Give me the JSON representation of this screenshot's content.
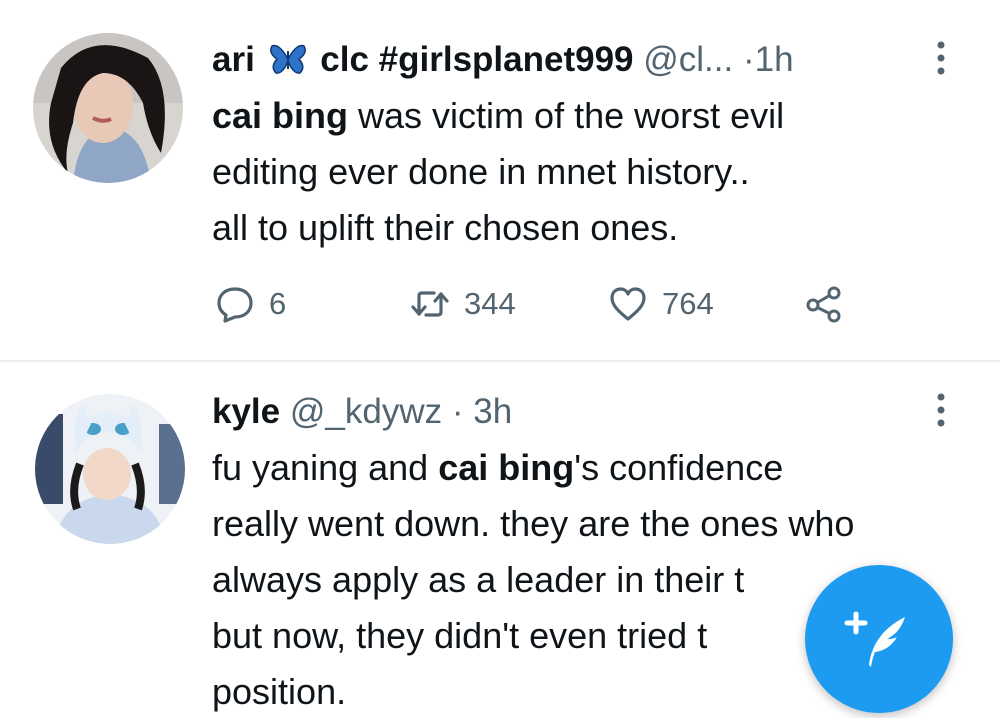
{
  "feed": {
    "tweets": [
      {
        "display_name": "ari",
        "name_suffix": "clc #girlsplanet999",
        "emoji_icon": "butterfly-icon",
        "handle": "@cl...",
        "separator": "·",
        "time": "1h",
        "body_lines": [
          {
            "bold": "cai bing",
            "rest": " was victim of the worst evil"
          },
          {
            "text": "editing ever done in mnet history.."
          },
          {
            "text": "all to uplift their chosen ones."
          }
        ],
        "stats": {
          "replies": "6",
          "retweets": "344",
          "likes": "764"
        }
      },
      {
        "display_name": "kyle",
        "handle": "@_kdywz",
        "separator": "·",
        "time": "3h",
        "body_lines": [
          {
            "pre": "fu yaning and ",
            "bold": "cai bing",
            "rest": "'s confidence"
          },
          {
            "text": "really went down. they are the ones who"
          },
          {
            "text": "always apply as a leader in their t"
          },
          {
            "text": "but now, they didn't even tried t"
          },
          {
            "text": "position."
          }
        ]
      }
    ]
  },
  "compose_button": {
    "icon": "compose-feather-plus-icon"
  },
  "colors": {
    "accent": "#1d9bf0",
    "text": "#0f1419",
    "muted": "#536471",
    "divider": "#eceef0"
  }
}
